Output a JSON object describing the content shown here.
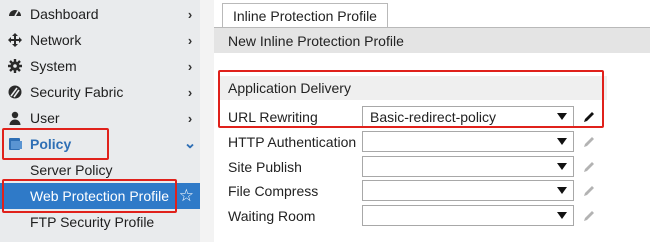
{
  "sidebar": {
    "items": [
      {
        "label": "Dashboard",
        "icon": "dashboard-icon",
        "chevron": "›"
      },
      {
        "label": "Network",
        "icon": "network-icon",
        "chevron": "›"
      },
      {
        "label": "System",
        "icon": "gear-icon",
        "chevron": "›"
      },
      {
        "label": "Security Fabric",
        "icon": "security-fabric-icon",
        "chevron": "›"
      },
      {
        "label": "User",
        "icon": "user-icon",
        "chevron": "›"
      },
      {
        "label": "Policy",
        "icon": "policy-icon",
        "chevron": "⌄"
      }
    ],
    "sub_items": [
      {
        "label": "Server Policy"
      },
      {
        "label": "Web Protection Profile",
        "active": true
      },
      {
        "label": "FTP Security Profile"
      }
    ],
    "star_glyph": "☆"
  },
  "main": {
    "tab_label": "Inline Protection Profile",
    "header_title": "New Inline Protection Profile",
    "section_title": "Application Delivery",
    "fields": [
      {
        "label": "URL Rewriting",
        "value": "Basic-redirect-policy",
        "editable": true
      },
      {
        "label": "HTTP Authentication",
        "value": "",
        "editable": false
      },
      {
        "label": "Site Publish",
        "value": "",
        "editable": false
      },
      {
        "label": "File Compress",
        "value": "",
        "editable": false
      },
      {
        "label": "Waiting Room",
        "value": "",
        "editable": false
      }
    ]
  },
  "colors": {
    "accent": "#2f7ac8",
    "highlight": "#e0211b",
    "sidebar_bg": "#e9ebed"
  }
}
